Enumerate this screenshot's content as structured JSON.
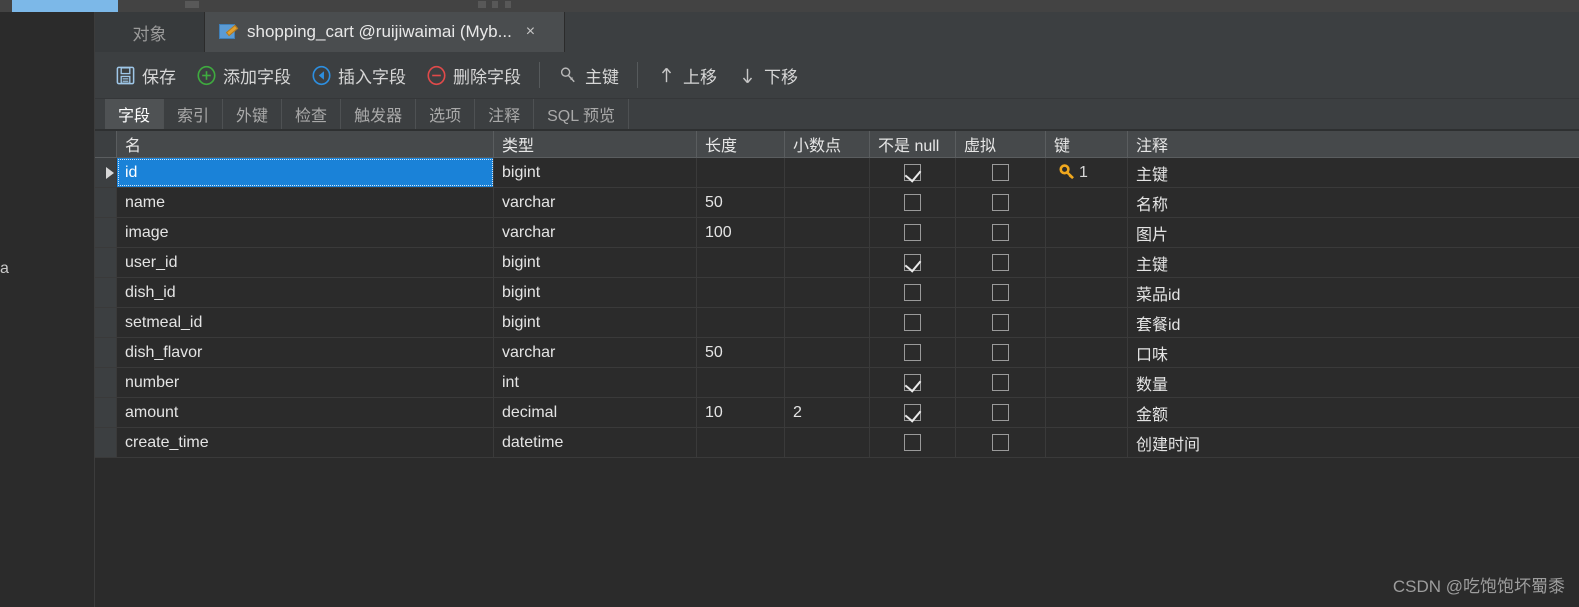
{
  "window": {
    "tabs": {
      "object_tab": "对象",
      "document_tab": "shopping_cart @ruijiwaimai (Myb...",
      "document_tab_close": "×"
    }
  },
  "left_fragment": "a",
  "toolbar": {
    "buttons": [
      {
        "label": "保存",
        "icon": "save-icon"
      },
      {
        "label": "添加字段",
        "icon": "add-circle-icon"
      },
      {
        "label": "插入字段",
        "icon": "insert-left-circle-icon"
      },
      {
        "label": "删除字段",
        "icon": "remove-circle-icon"
      },
      {
        "label": "主键",
        "icon": "key-icon"
      },
      {
        "label": "上移",
        "icon": "arrow-up-icon"
      },
      {
        "label": "下移",
        "icon": "arrow-down-icon"
      }
    ]
  },
  "subtabs": [
    {
      "label": "字段",
      "active": true
    },
    {
      "label": "索引",
      "active": false
    },
    {
      "label": "外键",
      "active": false
    },
    {
      "label": "检查",
      "active": false
    },
    {
      "label": "触发器",
      "active": false
    },
    {
      "label": "选项",
      "active": false
    },
    {
      "label": "注释",
      "active": false
    },
    {
      "label": "SQL 预览",
      "active": false
    }
  ],
  "grid": {
    "headers": {
      "name": "名",
      "type": "类型",
      "length": "长度",
      "decimals": "小数点",
      "not_null": "不是 null",
      "virtual": "虚拟",
      "key": "键",
      "comment": "注释"
    },
    "rows": [
      {
        "name": "id",
        "type": "bigint",
        "length": "",
        "decimals": "",
        "not_null": true,
        "virtual": false,
        "key": "1",
        "comment": "主键"
      },
      {
        "name": "name",
        "type": "varchar",
        "length": "50",
        "decimals": "",
        "not_null": false,
        "virtual": false,
        "key": "",
        "comment": "名称"
      },
      {
        "name": "image",
        "type": "varchar",
        "length": "100",
        "decimals": "",
        "not_null": false,
        "virtual": false,
        "key": "",
        "comment": "图片"
      },
      {
        "name": "user_id",
        "type": "bigint",
        "length": "",
        "decimals": "",
        "not_null": true,
        "virtual": false,
        "key": "",
        "comment": "主键"
      },
      {
        "name": "dish_id",
        "type": "bigint",
        "length": "",
        "decimals": "",
        "not_null": false,
        "virtual": false,
        "key": "",
        "comment": "菜品id"
      },
      {
        "name": "setmeal_id",
        "type": "bigint",
        "length": "",
        "decimals": "",
        "not_null": false,
        "virtual": false,
        "key": "",
        "comment": "套餐id"
      },
      {
        "name": "dish_flavor",
        "type": "varchar",
        "length": "50",
        "decimals": "",
        "not_null": false,
        "virtual": false,
        "key": "",
        "comment": "口味"
      },
      {
        "name": "number",
        "type": "int",
        "length": "",
        "decimals": "",
        "not_null": true,
        "virtual": false,
        "key": "",
        "comment": "数量"
      },
      {
        "name": "amount",
        "type": "decimal",
        "length": "10",
        "decimals": "2",
        "not_null": true,
        "virtual": false,
        "key": "",
        "comment": "金额"
      },
      {
        "name": "create_time",
        "type": "datetime",
        "length": "",
        "decimals": "",
        "not_null": false,
        "virtual": false,
        "key": "",
        "comment": "创建时间"
      }
    ],
    "selected_row_index": 0
  },
  "watermark": "CSDN @吃饱饱坏蜀黍",
  "colors": {
    "selection": "#1a82d8",
    "key_icon": "#f0a81e",
    "add_icon": "#3faa3f",
    "insert_icon": "#2d8fe0",
    "delete_icon": "#e04a4a",
    "chip": "#7cb8e8"
  }
}
